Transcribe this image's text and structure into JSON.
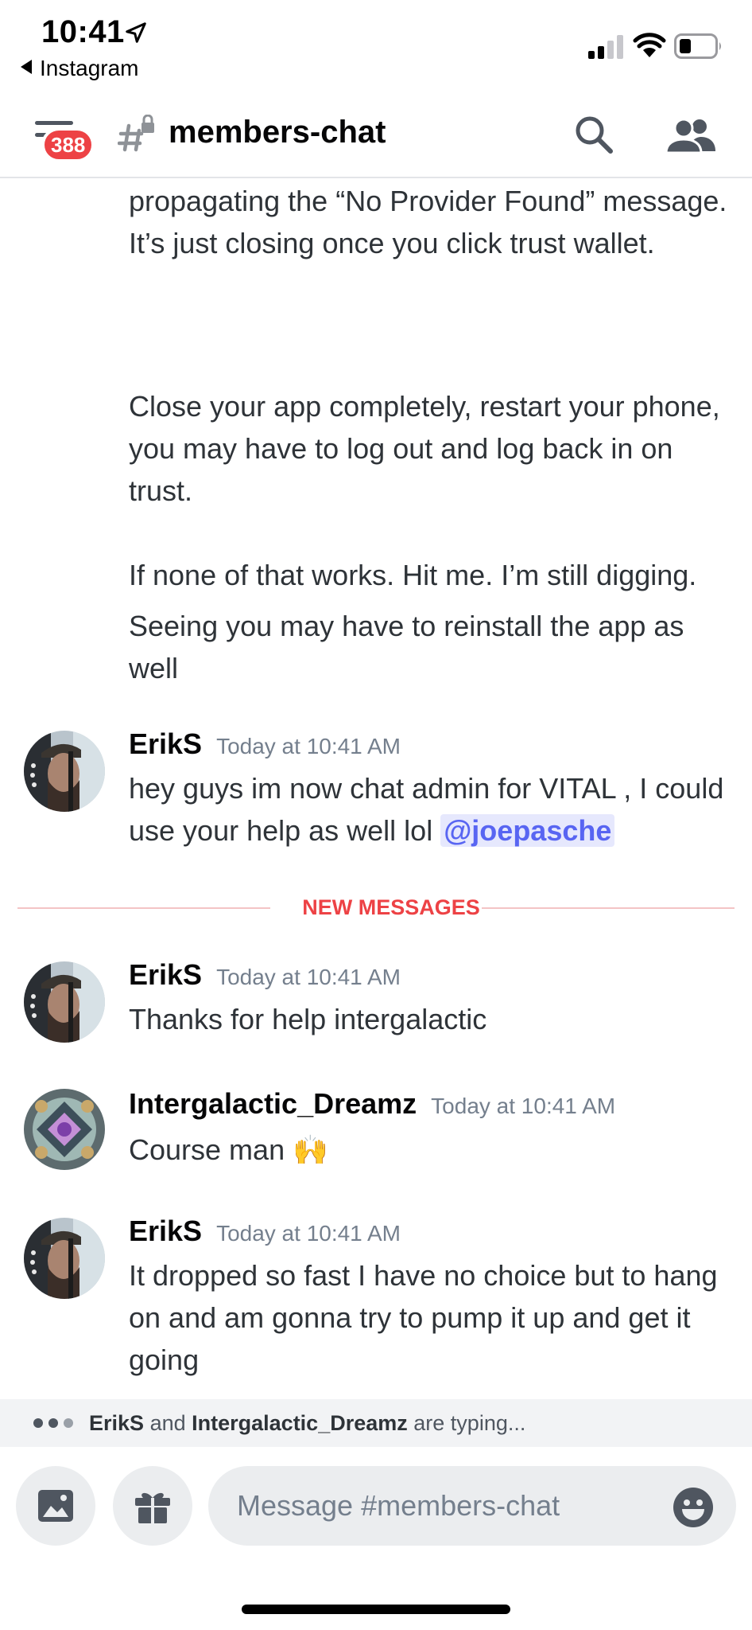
{
  "status_bar": {
    "time": "10:41",
    "back_app": "Instagram",
    "icons": [
      "location-arrow-icon",
      "cellular-signal-icon",
      "wifi-icon",
      "battery-icon"
    ]
  },
  "header": {
    "unread_badge": "388",
    "channel_name": "members-chat",
    "icons": [
      "hamburger-menu-icon",
      "locked-channel-hash-icon",
      "search-icon",
      "members-icon"
    ]
  },
  "continuation": {
    "lines_a": "propagating the “No Provider Found” message. It’s just closing once you click trust wallet.",
    "lines_b": "Close your app completely, restart your phone, you may have to log out and log back in on trust.",
    "lines_c": "If none of that works. Hit me. I’m still digging.",
    "lines_d": "Seeing you may have to reinstall the app as well"
  },
  "messages": [
    {
      "author": "ErikS",
      "time": "Today at 10:41 AM",
      "text": "hey guys im now chat admin for VITAL , I could use your help as well lol ",
      "mention": "@joepasche"
    },
    {
      "author": "ErikS",
      "time": "Today at 10:41 AM",
      "text": "Thanks for help intergalactic"
    },
    {
      "author": "Intergalactic_Dreamz",
      "time": "Today at 10:41 AM",
      "text": "Course man 🙌"
    },
    {
      "author": "ErikS",
      "time": "Today at 10:41 AM",
      "text": "It dropped so fast I have no choice but to hang on and am gonna try to pump it up and get it going"
    }
  ],
  "new_messages_divider": "NEW MESSAGES",
  "typing": {
    "user1": "ErikS",
    "and": "and",
    "user2": "Intergalactic_Dreamz",
    "suffix": "are typing..."
  },
  "composer": {
    "placeholder": "Message #members-chat",
    "icons": [
      "image-upload-icon",
      "gift-icon",
      "emoji-icon"
    ]
  },
  "colors": {
    "accent_red": "#ed4245",
    "mention_blue": "#5865f2",
    "text": "#2e3338",
    "muted": "#747f8d"
  }
}
